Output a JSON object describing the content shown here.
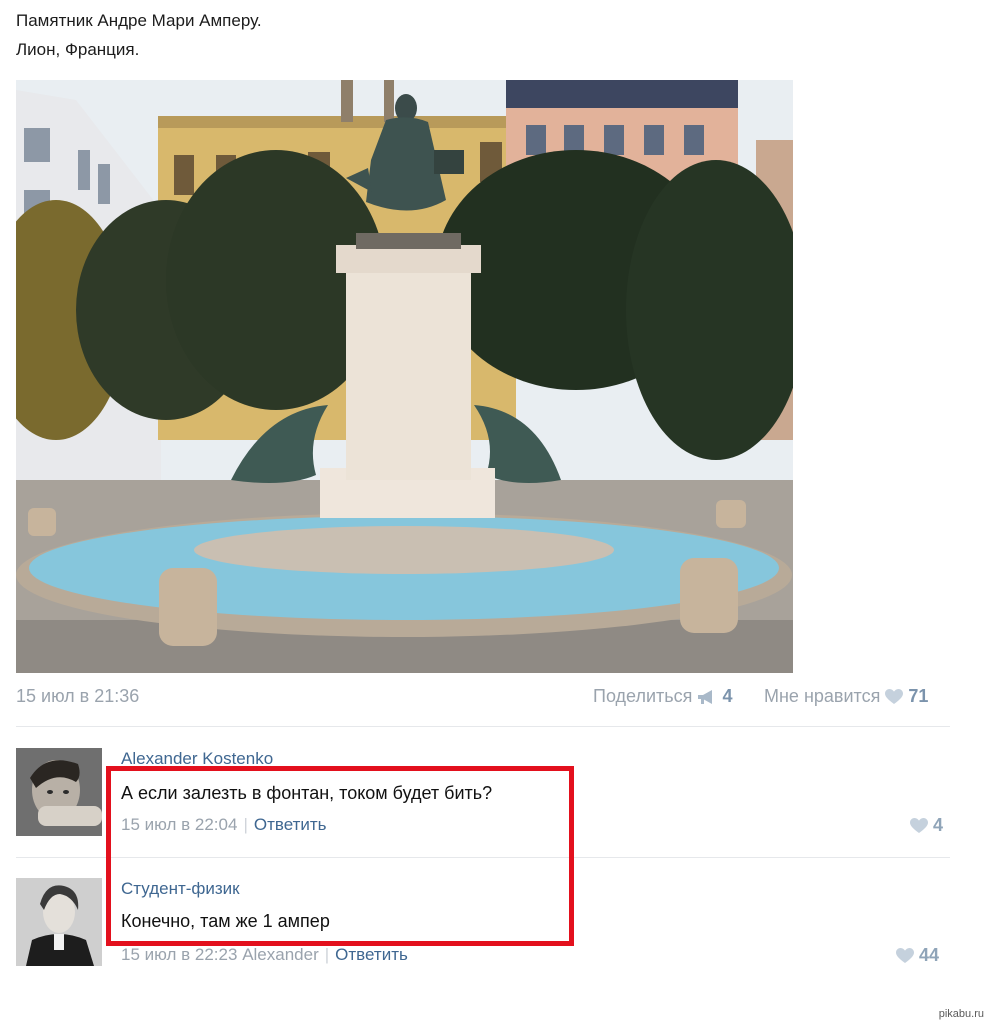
{
  "post": {
    "line1": "Памятник Андре Мари Амперу.",
    "line2": "Лион, Франция.",
    "date": "15 июл в 21:36",
    "share_label": "Поделиться",
    "share_count": "4",
    "like_label": "Мне нравится",
    "like_count": "71"
  },
  "comments": [
    {
      "author": "Alexander Kostenko",
      "text": "А если залезть в фонтан, током будет бить?",
      "date": "15 июл в 22:04",
      "reply_label": "Ответить",
      "likes": "4"
    },
    {
      "author": "Студент-физик",
      "text": "Конечно, там же 1 ампер",
      "date": "15 июл в 22:23",
      "reply_to": "Alexander",
      "reply_label": "Ответить",
      "likes": "44"
    }
  ],
  "icons": {
    "share": "megaphone-icon",
    "like": "heart-icon"
  },
  "colors": {
    "link": "#3f6791",
    "meta": "#9aa3ad",
    "highlight": "#e3101d"
  },
  "watermark": "pikabu.ru"
}
